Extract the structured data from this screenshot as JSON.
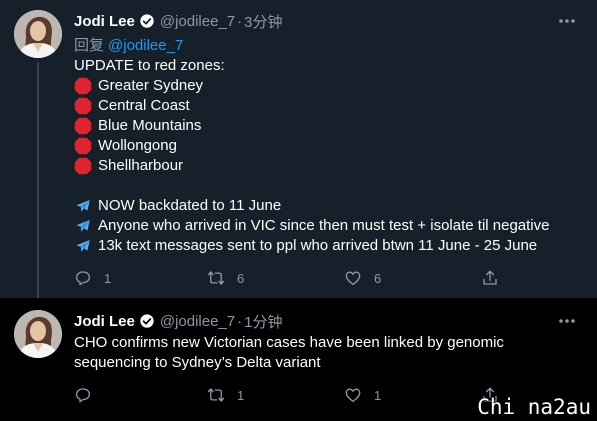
{
  "tweets": [
    {
      "name": "Jodi Lee",
      "handle": "@jodilee_7",
      "dot": "·",
      "time": "3分钟",
      "reply_prefix": "回复",
      "reply_handle": "@jodilee_7",
      "lines": [
        {
          "icon": "",
          "text": "UPDATE to red zones:"
        },
        {
          "icon": "stop-sign-icon",
          "text": "Greater Sydney"
        },
        {
          "icon": "stop-sign-icon",
          "text": "Central Coast"
        },
        {
          "icon": "stop-sign-icon",
          "text": "Blue Mountains"
        },
        {
          "icon": "stop-sign-icon",
          "text": "Wollongong"
        },
        {
          "icon": "stop-sign-icon",
          "text": "Shellharbour"
        },
        {
          "icon": "",
          "text": ""
        },
        {
          "icon": "airplane-icon",
          "text": "NOW backdated to 11 June"
        },
        {
          "icon": "airplane-icon",
          "text": "Anyone who arrived in VIC since then must test + isolate til negative"
        },
        {
          "icon": "airplane-icon",
          "text": "13k text messages sent to ppl who arrived btwn 11 June - 25 June"
        }
      ],
      "actions": {
        "reply": "1",
        "retweet": "6",
        "like": "6",
        "share": ""
      }
    },
    {
      "name": "Jodi Lee",
      "handle": "@jodilee_7",
      "dot": "·",
      "time": "1分钟",
      "lines": [
        {
          "icon": "",
          "text": "CHO confirms new Victorian cases have been linked by genomic"
        },
        {
          "icon": "",
          "text": "sequencing to Sydney’s Delta variant"
        }
      ],
      "actions": {
        "reply": "",
        "retweet": "1",
        "like": "1",
        "share": ""
      }
    }
  ],
  "watermark": "Chi na2au",
  "colors": {
    "background": "#15202b",
    "second_tweet_background": "#000000",
    "text": "#ffffff",
    "muted": "#8b98a5",
    "link": "#1d9bf0",
    "stop_sign": "#e0242e",
    "airplane": "#55acee"
  }
}
